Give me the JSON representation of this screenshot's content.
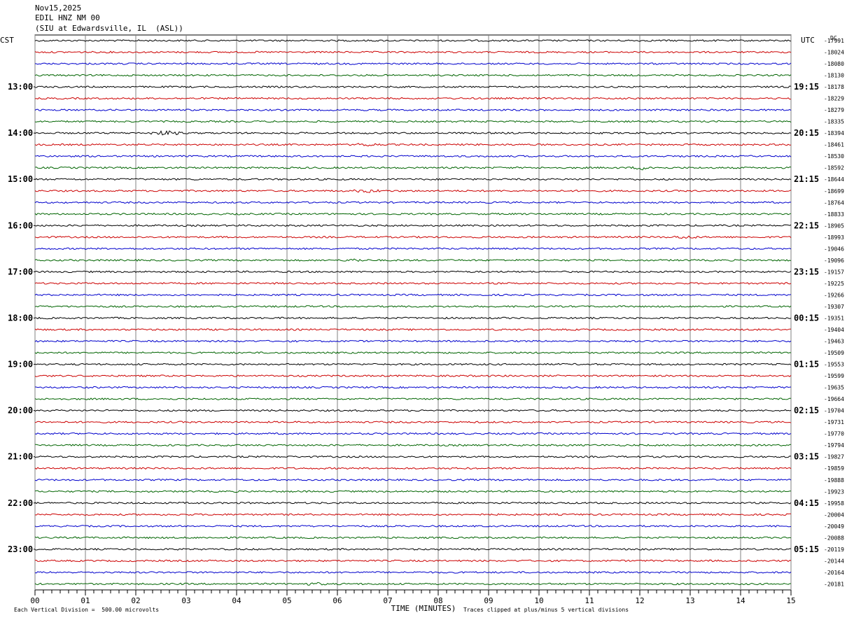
{
  "header": {
    "date": "Nov15,2025",
    "channel": "EDIL HNZ NM 00",
    "station": "(SIU at Edwardsville, IL  (ASL))"
  },
  "chart_data": {
    "type": "line",
    "plot": "helicorder",
    "left_axis_label": "CST",
    "right_axis_label": "UTC",
    "right_units": "DC",
    "xlabel": "TIME (MINUTES)",
    "x_ticks": [
      "00",
      "01",
      "02",
      "03",
      "04",
      "05",
      "06",
      "07",
      "08",
      "09",
      "10",
      "11",
      "12",
      "13",
      "14",
      "15"
    ],
    "xlim": [
      0,
      15
    ],
    "traces_per_hour": 4,
    "trace_colors": [
      "#000000",
      "#cc0000",
      "#0000cc",
      "#006400"
    ],
    "left_hour_labels": [
      "13:00",
      "14:00",
      "15:00",
      "16:00",
      "17:00",
      "18:00",
      "19:00",
      "20:00",
      "21:00",
      "22:00",
      "23:00"
    ],
    "right_hour_labels": [
      "19:15",
      "20:15",
      "21:15",
      "22:15",
      "23:15",
      "00:15",
      "01:15",
      "02:15",
      "03:15",
      "04:15",
      "05:15"
    ],
    "dc_offsets": [
      "-17991",
      "-18024",
      "-18080",
      "-18130",
      "-18178",
      "-18229",
      "-18279",
      "-18335",
      "-18394",
      "-18461",
      "-18530",
      "-18592",
      "-18644",
      "-18699",
      "-18764",
      "-18833",
      "-18905",
      "-18993",
      "-19046",
      "-19096",
      "-19157",
      "-19225",
      "-19266",
      "-19307",
      "-19351",
      "-19404",
      "-19463",
      "-19509",
      "-19553",
      "-19599",
      "-19635",
      "-19664",
      "-19704",
      "-19731",
      "-19770",
      "-19794",
      "-19827",
      "-19859",
      "-19888",
      "-19923",
      "-19958",
      "-20004",
      "-20049",
      "-20088",
      "-20119",
      "-20144",
      "-20164",
      "-20181"
    ],
    "events": [
      {
        "trace": 8,
        "start_min": 2.2,
        "end_min": 3.0,
        "amplitude": 2.5
      },
      {
        "trace": 9,
        "start_min": 6.3,
        "end_min": 6.9,
        "amplitude": 1.8
      },
      {
        "trace": 11,
        "start_min": 11.8,
        "end_min": 12.4,
        "amplitude": 2.5
      },
      {
        "trace": 13,
        "start_min": 6.2,
        "end_min": 7.0,
        "amplitude": 1.6
      },
      {
        "trace": 17,
        "start_min": 12.6,
        "end_min": 13.2,
        "amplitude": 1.5
      },
      {
        "trace": 19,
        "start_min": 6.1,
        "end_min": 6.6,
        "amplitude": 1.6
      },
      {
        "trace": 47,
        "start_min": 5.3,
        "end_min": 5.8,
        "amplitude": 1.5
      }
    ]
  },
  "footer": {
    "scale_note": "Each Vertical Division =  500.00 microvolts",
    "clip_note": "Traces clipped at plus/minus 5 vertical divisions"
  }
}
